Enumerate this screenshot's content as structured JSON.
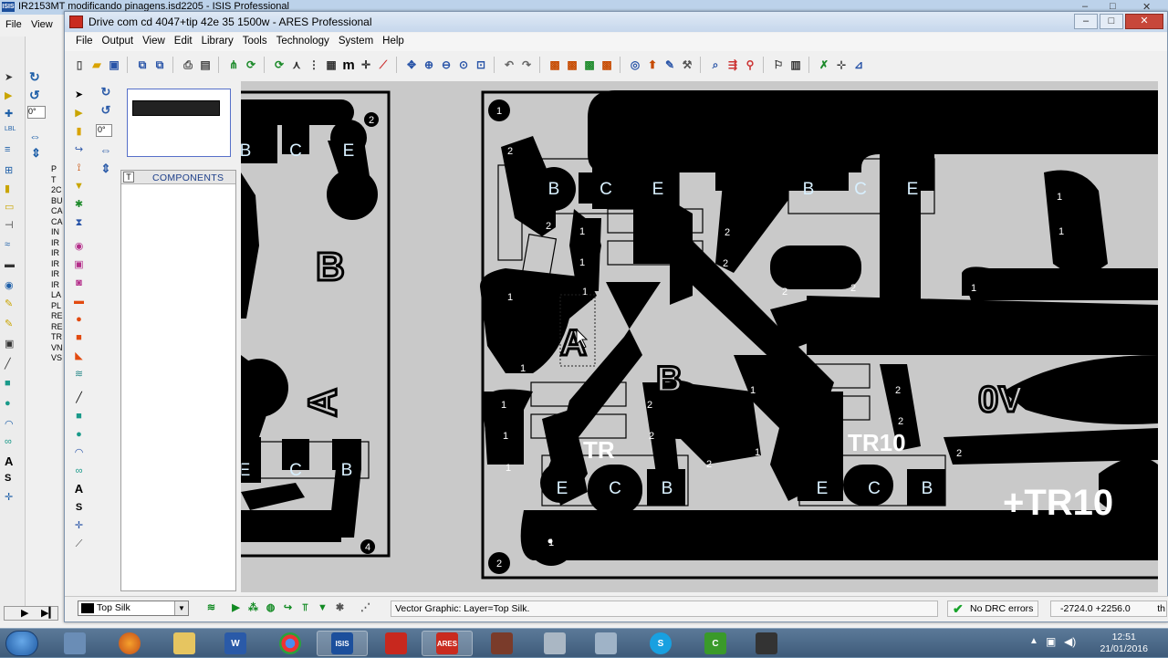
{
  "isis": {
    "title": "IR2153MT modificando pinagens.isd2205 - ISIS Professional",
    "menu": [
      "File",
      "View"
    ],
    "angle": "0°",
    "strip_items": [
      "P",
      "T",
      "2C",
      "BU",
      "CA",
      "CA",
      "IN",
      "IR",
      "IR",
      "IR",
      "IR",
      "IR",
      "LA",
      "PL",
      "RE",
      "RE",
      "TR",
      "VN",
      "VS"
    ]
  },
  "ares": {
    "title": "Drive com cd 4047+tip 42e 35 1500w - ARES Professional",
    "menu": [
      "File",
      "Output",
      "View",
      "Edit",
      "Library",
      "Tools",
      "Technology",
      "System",
      "Help"
    ],
    "angle": "0°",
    "window_controls": {
      "minimize": "–",
      "maximize": "□",
      "close": "✕"
    }
  },
  "components_panel": {
    "tab_label": "T",
    "title": "COMPONENTS"
  },
  "pcb": {
    "pad_labels_top_left": [
      "B",
      "C",
      "E"
    ],
    "pad_labels_top_mid": [
      "B",
      "C",
      "E"
    ],
    "pad_labels_top_right": [
      "B",
      "C",
      "E"
    ],
    "pad_labels_bot_left": [
      "E",
      "C",
      "B"
    ],
    "pad_labels_bot_mid": [
      "E",
      "C",
      "B"
    ],
    "pad_labels_bot_right": [
      "E",
      "C",
      "B"
    ],
    "silk_texts": [
      "B",
      "A",
      "0V",
      "+TR10",
      "B",
      "TR",
      "TR10",
      "A"
    ],
    "hole_numbers": [
      "1",
      "2",
      "2",
      "4"
    ],
    "pin_numbers": [
      "1",
      "2",
      "2",
      "1",
      "1",
      "1",
      "1",
      "2",
      "2",
      "2",
      "2",
      "1",
      "1",
      "1",
      "1",
      "1",
      "2",
      "2",
      "2",
      "2",
      "2",
      "1",
      "1",
      "2",
      "1",
      "1"
    ]
  },
  "status": {
    "layer": "Top Silk",
    "message": "Vector Graphic: Layer=Top Silk.",
    "drc": "No DRC errors",
    "coords": "-2724.0   +2256.0",
    "units": "th"
  },
  "taskbar": {
    "apps": [
      {
        "name": "explorer-app",
        "label": ""
      },
      {
        "name": "firefox-app",
        "label": ""
      },
      {
        "name": "files-app",
        "label": ""
      },
      {
        "name": "word-app",
        "label": "W"
      },
      {
        "name": "chrome-app",
        "label": ""
      },
      {
        "name": "isis-app",
        "label": "ISIS"
      },
      {
        "name": "acrobat-app",
        "label": ""
      },
      {
        "name": "ares-app",
        "label": "ARES"
      },
      {
        "name": "media-app",
        "label": ""
      },
      {
        "name": "misc-app",
        "label": ""
      },
      {
        "name": "calculator-app",
        "label": ""
      },
      {
        "name": "skype-app",
        "label": "S"
      },
      {
        "name": "camtasia-app",
        "label": "C"
      },
      {
        "name": "recorder-app",
        "label": ""
      }
    ],
    "time": "12:51",
    "date": "21/01/2016"
  },
  "colors": {
    "copper": "#000000",
    "board": "#c9c9c9",
    "pad_text": "#d8f0ff",
    "accent_ares": "#c92b1f",
    "drc_ok": "#17a32a"
  }
}
